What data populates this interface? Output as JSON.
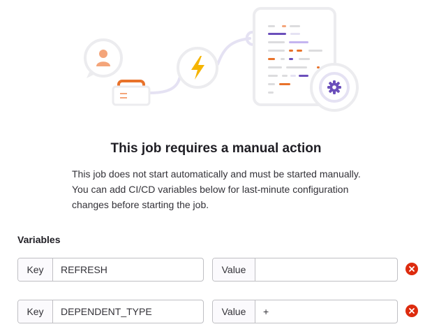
{
  "empty_state": {
    "title": "This job requires a manual action",
    "description": "This job does not start automatically and must be started manually. You can add CI/CD variables below for last-minute configuration changes before starting the job."
  },
  "variables": {
    "label": "Variables",
    "rows": [
      {
        "key_label": "Key",
        "key_value": "REFRESH",
        "value_label": "Value",
        "value_value": ""
      },
      {
        "key_label": "Key",
        "key_value": "DEPENDENT_TYPE",
        "value_label": "Value",
        "value_value": "+"
      }
    ]
  },
  "colors": {
    "accent_orange": "#e8722a",
    "accent_purple": "#6b4fbb",
    "danger": "#dd2b0e",
    "lightning": "#f5b400"
  }
}
